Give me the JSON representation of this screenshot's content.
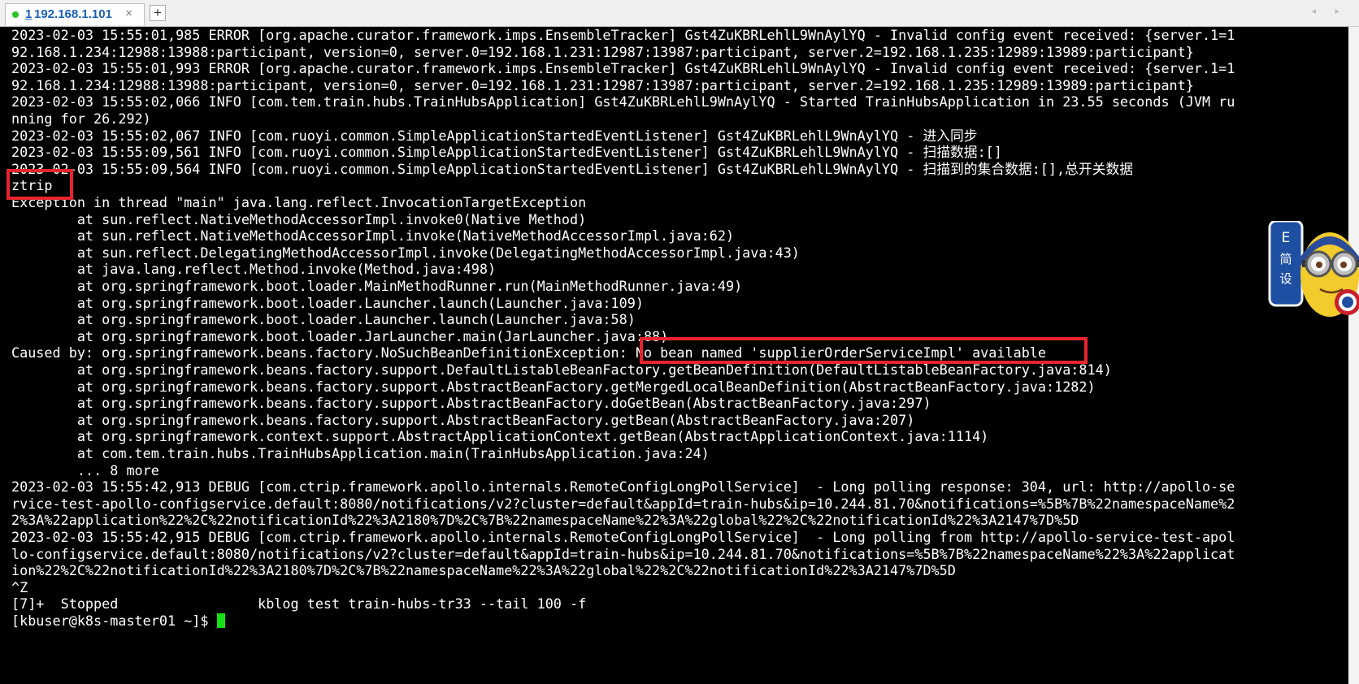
{
  "tab": {
    "status_color": "#27c427",
    "number": "1",
    "title": "192.168.1.101",
    "close_glyph": "×"
  },
  "new_tab_glyph": "+",
  "scroll_arrows": "◂ ▸",
  "terminal": {
    "lines": [
      "2023-02-03 15:55:01,985 ERROR [org.apache.curator.framework.imps.EnsembleTracker] Gst4ZuKBRLehlL9WnAylYQ - Invalid config event received: {server.1=1",
      "92.168.1.234:12988:13988:participant, version=0, server.0=192.168.1.231:12987:13987:participant, server.2=192.168.1.235:12989:13989:participant}",
      "2023-02-03 15:55:01,993 ERROR [org.apache.curator.framework.imps.EnsembleTracker] Gst4ZuKBRLehlL9WnAylYQ - Invalid config event received: {server.1=1",
      "92.168.1.234:12988:13988:participant, version=0, server.0=192.168.1.231:12987:13987:participant, server.2=192.168.1.235:12989:13989:participant}",
      "2023-02-03 15:55:02,066 INFO [com.tem.train.hubs.TrainHubsApplication] Gst4ZuKBRLehlL9WnAylYQ - Started TrainHubsApplication in 23.55 seconds (JVM ru",
      "nning for 26.292)",
      "2023-02-03 15:55:02,067 INFO [com.ruoyi.common.SimpleApplicationStartedEventListener] Gst4ZuKBRLehlL9WnAylYQ - 进入同步",
      "2023-02-03 15:55:09,561 INFO [com.ruoyi.common.SimpleApplicationStartedEventListener] Gst4ZuKBRLehlL9WnAylYQ - 扫描数据:[]",
      "2023-02-03 15:55:09,564 INFO [com.ruoyi.common.SimpleApplicationStartedEventListener] Gst4ZuKBRLehlL9WnAylYQ - 扫描到的集合数据:[],总开关数据",
      "ztrip",
      "Exception in thread \"main\" java.lang.reflect.InvocationTargetException",
      "        at sun.reflect.NativeMethodAccessorImpl.invoke0(Native Method)",
      "        at sun.reflect.NativeMethodAccessorImpl.invoke(NativeMethodAccessorImpl.java:62)",
      "        at sun.reflect.DelegatingMethodAccessorImpl.invoke(DelegatingMethodAccessorImpl.java:43)",
      "        at java.lang.reflect.Method.invoke(Method.java:498)",
      "        at org.springframework.boot.loader.MainMethodRunner.run(MainMethodRunner.java:49)",
      "        at org.springframework.boot.loader.Launcher.launch(Launcher.java:109)",
      "        at org.springframework.boot.loader.Launcher.launch(Launcher.java:58)",
      "        at org.springframework.boot.loader.JarLauncher.main(JarLauncher.java:88)",
      "Caused by: org.springframework.beans.factory.NoSuchBeanDefinitionException: No bean named 'supplierOrderServiceImpl' available",
      "        at org.springframework.beans.factory.support.DefaultListableBeanFactory.getBeanDefinition(DefaultListableBeanFactory.java:814)",
      "        at org.springframework.beans.factory.support.AbstractBeanFactory.getMergedLocalBeanDefinition(AbstractBeanFactory.java:1282)",
      "        at org.springframework.beans.factory.support.AbstractBeanFactory.doGetBean(AbstractBeanFactory.java:297)",
      "        at org.springframework.beans.factory.support.AbstractBeanFactory.getBean(AbstractBeanFactory.java:207)",
      "        at org.springframework.context.support.AbstractApplicationContext.getBean(AbstractApplicationContext.java:1114)",
      "        at com.tem.train.hubs.TrainHubsApplication.main(TrainHubsApplication.java:24)",
      "        ... 8 more",
      "2023-02-03 15:55:42,913 DEBUG [com.ctrip.framework.apollo.internals.RemoteConfigLongPollService]  - Long polling response: 304, url: http://apollo-se",
      "rvice-test-apollo-configservice.default:8080/notifications/v2?cluster=default&appId=train-hubs&ip=10.244.81.70&notifications=%5B%7B%22namespaceName%2",
      "2%3A%22application%22%2C%22notificationId%22%3A2180%7D%2C%7B%22namespaceName%22%3A%22global%22%2C%22notificationId%22%3A2147%7D%5D",
      "2023-02-03 15:55:42,915 DEBUG [com.ctrip.framework.apollo.internals.RemoteConfigLongPollService]  - Long polling from http://apollo-service-test-apol",
      "lo-configservice.default:8080/notifications/v2?cluster=default&appId=train-hubs&ip=10.244.81.70&notifications=%5B%7B%22namespaceName%22%3A%22applicat",
      "ion%22%2C%22notificationId%22%3A2180%7D%2C%7B%22namespaceName%22%3A%22global%22%2C%22notificationId%22%3A2147%7D%5D",
      "^Z",
      "[7]+  Stopped                 kblog test train-hubs-tr33 --tail 100 -f",
      "[kbuser@k8s-master01 ~]$ "
    ],
    "text_color": "#ffffff",
    "cursor_color": "#13e113"
  },
  "highlight_color": "#e8242c",
  "avatar": {
    "icon": "minion-avatar-icon",
    "badge_text": "E 简 设"
  }
}
